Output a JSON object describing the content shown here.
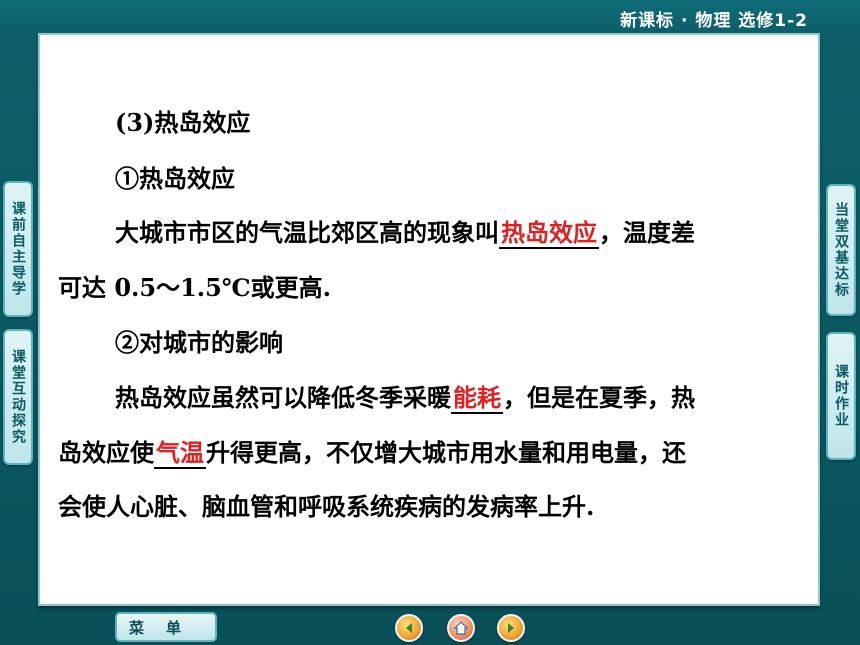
{
  "header": {
    "title": "新课标 · 物理    选修1-2"
  },
  "content": {
    "heading": "(3)热岛效应",
    "subheading1": "①热岛效应",
    "p1_before": "大城市市区的气温比郊区高的现象叫",
    "p1_blank": "热岛效应",
    "p1_after": "，温度差",
    "p1_line2": "可达 0.5～1.5℃或更高.",
    "subheading2": "②对城市的影响",
    "p2_before": "热岛效应虽然可以降低冬季采暖",
    "p2_blank1": "能耗",
    "p2_mid": "，但是在夏季，热",
    "p2_line2_before": "岛效应使",
    "p2_blank2": "气温",
    "p2_line2_after": "升得更高，不仅增大城市用水量和用电量，还",
    "p2_line3": "会使人心脏、脑血管和呼吸系统疾病的发病率上升."
  },
  "left_tabs": [
    {
      "label": "课前自主导学"
    },
    {
      "label": "课堂互动探究"
    }
  ],
  "right_tabs": [
    {
      "label": "当堂双基达标"
    },
    {
      "label": "课时作业"
    }
  ],
  "bottom": {
    "menu_label": "菜单",
    "nav_icons": [
      "prev-icon",
      "home-icon",
      "next-icon"
    ]
  },
  "colors": {
    "accent": "#0d5f69",
    "answer": "#e02020"
  }
}
